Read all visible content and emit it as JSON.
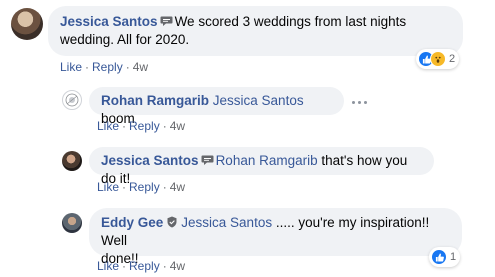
{
  "comments": [
    {
      "author": "Jessica Santos",
      "text": "We scored 3 weddings from last nights wedding. All for 2020.",
      "actions": {
        "like": "Like",
        "reply": "Reply",
        "time": "4w"
      },
      "reactions": {
        "count": "2",
        "types": [
          "like-icon",
          "wow-icon"
        ]
      }
    },
    {
      "author": "Rohan Ramgarib",
      "mention": "Jessica Santos",
      "text": "boom",
      "actions": {
        "like": "Like",
        "reply": "Reply",
        "time": "4w"
      }
    },
    {
      "author": "Jessica Santos",
      "mention": "Rohan Ramgarib",
      "text": "that's how you do it!",
      "actions": {
        "like": "Like",
        "reply": "Reply",
        "time": "4w"
      }
    },
    {
      "author": "Eddy Gee",
      "mention": "Jessica Santos",
      "text_line1": "..... you're my inspiration!! Well",
      "text_line2": "done!!",
      "actions": {
        "like": "Like",
        "reply": "Reply",
        "time": "4w"
      },
      "reactions": {
        "count": "1",
        "types": [
          "like-icon"
        ]
      }
    }
  ],
  "separator": "·",
  "colors": {
    "link": "#385898",
    "bubble": "#f0f2f5",
    "meta": "#65676b",
    "like": "#1877f2",
    "wow": "#f7b928"
  }
}
